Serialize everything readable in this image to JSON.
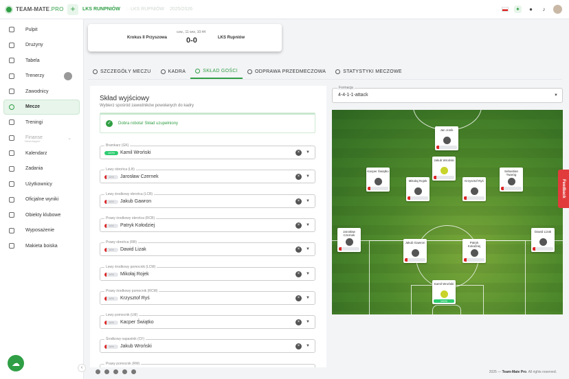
{
  "topbar": {
    "logo_text": "TEAM-MATE",
    "logo_suffix": ".PRO",
    "team_active": "LKS RUNPNIÓW",
    "team_inactive": "LKS RUPNIÓW",
    "season": "2025/2026",
    "plus": "+"
  },
  "sidebar": [
    {
      "label": "Pulpit",
      "icon": "dashboard-icon"
    },
    {
      "label": "Drużyny",
      "icon": "teams-icon"
    },
    {
      "label": "Tabela",
      "icon": "table-icon"
    },
    {
      "label": "Trenerzy",
      "icon": "coach-icon"
    },
    {
      "label": "Zawodnicy",
      "icon": "players-icon"
    },
    {
      "label": "Mecze",
      "icon": "ball-icon",
      "active": true
    },
    {
      "label": "Treningi",
      "icon": "training-icon"
    },
    {
      "label": "Finanse",
      "icon": "finance-icon",
      "disabled": true,
      "sub": "Niedostępne"
    },
    {
      "label": "Kalendarz",
      "icon": "calendar-icon"
    },
    {
      "label": "Zadania",
      "icon": "tasks-icon"
    },
    {
      "label": "Użytkownicy",
      "icon": "users-icon"
    },
    {
      "label": "Oficjalne wyniki",
      "icon": "globe-icon"
    },
    {
      "label": "Obiekty klubowe",
      "icon": "facility-icon"
    },
    {
      "label": "Wyposażenie",
      "icon": "equipment-icon"
    },
    {
      "label": "Makieta boiska",
      "icon": "pitch-icon"
    }
  ],
  "match": {
    "home": "Krokus II Przyszowa",
    "away": "LKS Rupniów",
    "date": "czw., 11 wrz, 10:44",
    "score": "0-0"
  },
  "tabs": [
    {
      "label": "SZCZEGÓŁY MECZU",
      "icon": "eye-icon"
    },
    {
      "label": "KADRA",
      "icon": "squad-icon"
    },
    {
      "label": "SKŁAD GOŚCI",
      "icon": "lineup-icon",
      "active": true
    },
    {
      "label": "ODPRAWA PRZEDMECZOWA",
      "icon": "briefing-icon"
    },
    {
      "label": "STATYSTYKI MECZOWE",
      "icon": "stats-icon"
    }
  ],
  "lineup": {
    "title": "Skład wyjściowy",
    "subtitle": "Wybierz spośród zawodników powołanych do kadry",
    "success": "Dobra robota! Skład uzupełniony",
    "positions": [
      {
        "label": "Bramkarz (GK)",
        "player": "Kamil Wroński",
        "badge": "100%",
        "full": true
      },
      {
        "label": "Lewy obrońca (LB)",
        "player": "Jarosław Czernek",
        "badge": "14%"
      },
      {
        "label": "Lewy środkowy obrońca (LCB)",
        "player": "Jakub Gawron",
        "badge": "14%"
      },
      {
        "label": "Prawy środkowy obrońca (RCB)",
        "player": "Patryk Kołodziej",
        "badge": "14%"
      },
      {
        "label": "Prawy obrońca (RB)",
        "player": "Dawid Lizak",
        "badge": "14%"
      },
      {
        "label": "Lewy środkowy pomocnik (LCM)",
        "player": "Mikołaj Rojek",
        "badge": "14%"
      },
      {
        "label": "Prawy środkowy pomocnik (RCM)",
        "player": "Krzysztof Ryś",
        "badge": "14%"
      },
      {
        "label": "Lewy pomocnik (LM)",
        "player": "Kacper Świątko",
        "badge": "14%"
      },
      {
        "label": "Środkowy napastnik (CF)",
        "player": "Jakub Wroński",
        "badge": "14%"
      },
      {
        "label": "Prawy pomocnik (RM)",
        "player": "",
        "badge": ""
      }
    ]
  },
  "formation": {
    "label": "Formacja",
    "value": "4-4-1-1-attack"
  },
  "pitch_players": [
    {
      "name": "Jan Jonik",
      "photo": "dark"
    },
    {
      "name": "Jakub Wroński",
      "photo": "yellow"
    },
    {
      "name": "Kacper Świątko",
      "photo": "dark"
    },
    {
      "name": "Mikołaj Rojek",
      "photo": "dark"
    },
    {
      "name": "Krzysztof Ryś",
      "photo": "dark"
    },
    {
      "name": "Sebastian Twarög",
      "photo": "dark"
    },
    {
      "name": "Jarosław Czernek",
      "photo": "dark"
    },
    {
      "name": "Jakub Gawron",
      "photo": "dark"
    },
    {
      "name": "Patryk Kołodziej",
      "photo": "dark"
    },
    {
      "name": "Dawid Lizak",
      "photo": "dark"
    },
    {
      "name": "Kamil Wroński",
      "photo": "yellow",
      "full": "100%"
    }
  ],
  "feedback": "Feedback",
  "footer": {
    "copy_pre": "2025 — ",
    "brand": "Team-Mate Pro",
    "copy_post": ". All rights reserved."
  }
}
